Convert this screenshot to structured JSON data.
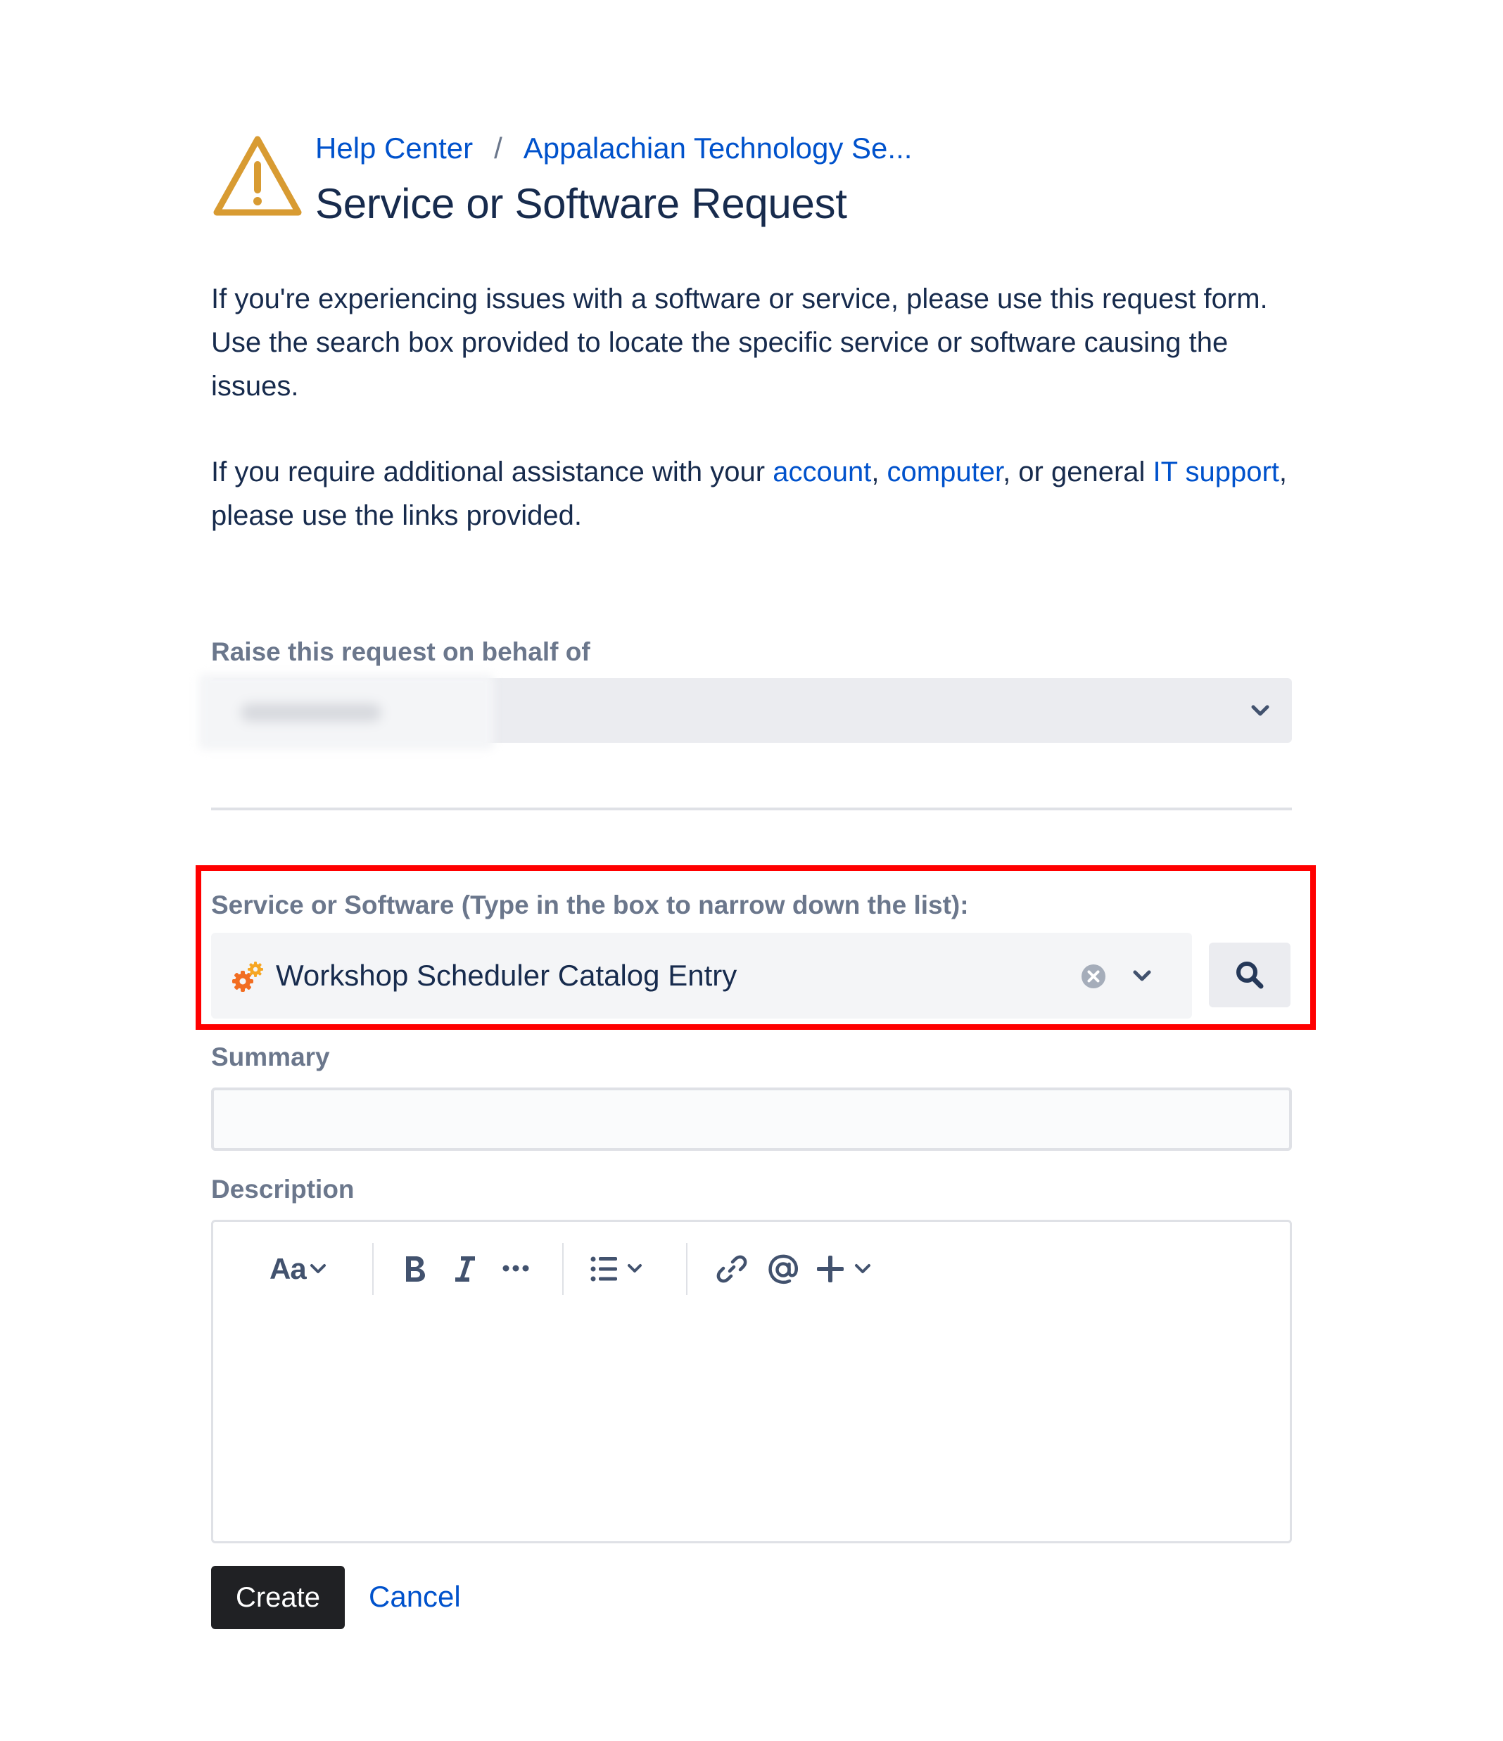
{
  "header": {
    "breadcrumb": [
      {
        "label": "Help Center"
      },
      {
        "label": "Appalachian Technology Se..."
      }
    ],
    "separator": "/",
    "title": "Service or Software Request",
    "icon": "warning-triangle-icon",
    "icon_color": "#d89b32"
  },
  "intro": {
    "paragraph1": "If you're experiencing issues with a software or service, please use this request form. Use the search box provided to locate the specific service or software causing the issues.",
    "p2_start": "If you require additional assistance with your ",
    "link_account": "account",
    "sep1": ", ",
    "link_computer": "computer",
    "sep2": ", or general ",
    "link_it_support": "IT support",
    "p2_end": ", please use the links provided."
  },
  "form": {
    "behalf_label": "Raise this request on behalf of",
    "service_label": "Service or Software (Type in the box to narrow down the list):",
    "service_value": "Workshop Scheduler Catalog Entry",
    "summary_label": "Summary",
    "summary_value": "",
    "description_label": "Description",
    "editor_text_style": "Aa",
    "create_label": "Create",
    "cancel_label": "Cancel"
  },
  "colors": {
    "link": "#0052cc",
    "highlight": "#ff0000",
    "field_bg": "#f4f5f7",
    "create_bg": "#202124"
  }
}
